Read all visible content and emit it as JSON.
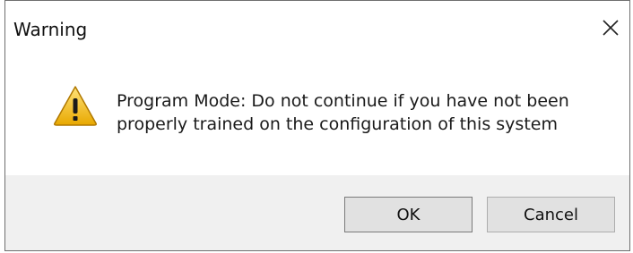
{
  "window": {
    "title": "Warning",
    "close_icon": "close-icon"
  },
  "message": {
    "icon": "warning-icon",
    "line1": "Program Mode: Do not continue if you have not been",
    "line2": "properly trained on the configuration of this system"
  },
  "buttons": {
    "ok_label": "OK",
    "cancel_label": "Cancel"
  },
  "colors": {
    "warning_fill": "#f4c430",
    "warning_mark": "#1a1a1a",
    "footer_bg": "#f0f0f0",
    "button_bg": "#e1e1e1"
  }
}
